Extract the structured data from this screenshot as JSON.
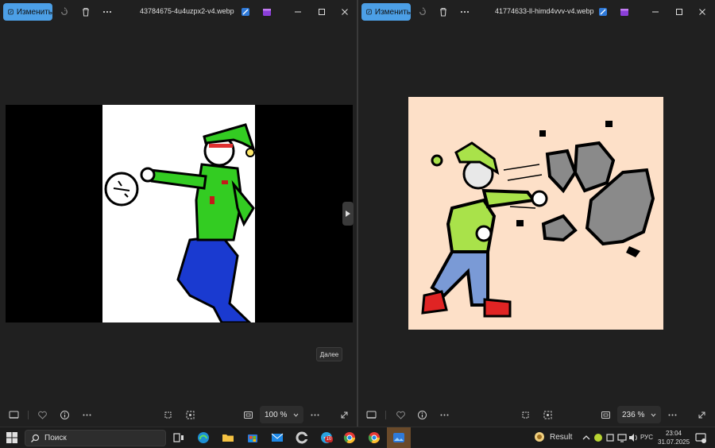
{
  "left_window": {
    "edit_label": "Изменить",
    "filename": "43784675-4u4uzpx2-v4.webp",
    "zoom": "100 %",
    "tooltip": "Далее"
  },
  "right_window": {
    "edit_label": "Изменить",
    "filename": "41774633-ll-himd4vvv-v4.webp",
    "zoom": "236 %"
  },
  "taskbar": {
    "search_placeholder": "Поиск",
    "mail_badge": "10",
    "result_label": "Result",
    "language": "РУС",
    "time": "23:04",
    "date": "31.07.2025",
    "notification_count": "1"
  },
  "colors": {
    "accent": "#4c9fe6",
    "background": "#202020",
    "elf_green": "#33cc22",
    "pants_blue": "#1a3ad0",
    "right_bg": "#fde0c8"
  }
}
